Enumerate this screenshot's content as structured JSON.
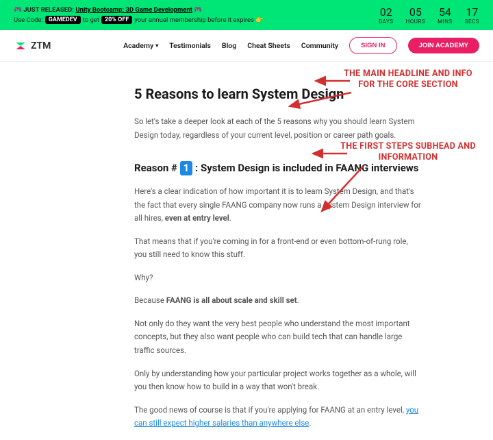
{
  "promo": {
    "prefix": "🎮 JUST RELEASED: ",
    "link_text": "Unity Bootcamp: 3D Game Development",
    "suffix": " 🎮",
    "sub_prefix": "Use Code: ",
    "code_badge": "GAMEDEV",
    "sub_mid": " to get ",
    "discount_badge": "20% OFF",
    "sub_suffix": " your annual membership before it expires 👉"
  },
  "countdown": {
    "days_num": "02",
    "days_label": "DAYS",
    "hours_num": "05",
    "hours_label": "HOURS",
    "mins_num": "54",
    "mins_label": "MINS",
    "secs_num": "17",
    "secs_label": "SECS"
  },
  "header": {
    "brand": "ZTM",
    "nav": {
      "academy": "Academy",
      "testimonials": "Testimonials",
      "blog": "Blog",
      "cheatsheets": "Cheat Sheets",
      "community": "Community"
    },
    "signin": "SIGN IN",
    "join": "JOIN ACADEMY"
  },
  "article": {
    "h1": "5 Reasons to learn System Design",
    "intro": "So let's take a deeper look at each of the 5 reasons why you should learn System Design today, regardless of your current level, position or career path goals.",
    "h2_pre": "Reason # ",
    "h2_num": "1",
    "h2_post": " : System Design is included in FAANG interviews",
    "p1_pre": "Here's a clear indication of how important it is to learn System Design, and that's the fact that every single FAANG company now runs a System Design interview for all hires, ",
    "p1_bold": "even at entry level",
    "p1_post": ".",
    "p2": "That means that if you're coming in for a front-end or even bottom-of-rung role, you still need to know this stuff.",
    "p3": "Why?",
    "p4_pre": "Because ",
    "p4_bold": "FAANG is all about scale and skill set",
    "p4_post": ".",
    "p5": "Not only do they want the very best people who understand the most important concepts, but they also want people who can build tech that can handle large traffic sources.",
    "p6": "Only by understanding how your particular project works together as a whole, will you then know how to build in a way that won't break.",
    "p7_pre": "The good news of course is that if you're applying for FAANG at an entry level, ",
    "p7_link": "you can still expect higher salaries than anywhere else",
    "p7_post": "."
  },
  "annotations": {
    "a1": "THE MAIN HEADLINE AND INFO FOR THE CORE SECTION",
    "a2": "THE FIRST STEPS SUBHEAD AND INFORMATION"
  }
}
